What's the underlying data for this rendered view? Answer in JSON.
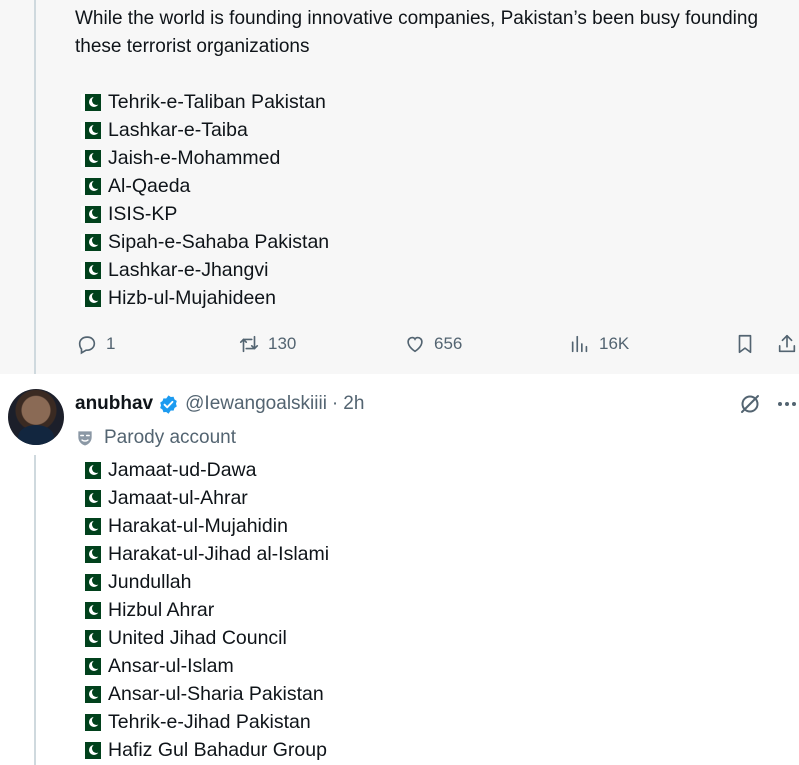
{
  "post1": {
    "intro": "While the world is founding innovative companies, Pakistan’s been busy founding these terrorist organizations",
    "items": [
      "Tehrik-e-Taliban Pakistan",
      "Lashkar-e-Taiba",
      "Jaish-e-Mohammed",
      "Al-Qaeda",
      "ISIS-KP",
      "Sipah-e-Sahaba Pakistan",
      "Lashkar-e-Jhangvi",
      "Hizb-ul-Mujahideen"
    ],
    "actions": {
      "replies": "1",
      "reposts": "130",
      "likes": "656",
      "views": "16K"
    }
  },
  "post2": {
    "display_name": "anubhav",
    "handle": "@Iewangoalskiiii",
    "separator": "·",
    "time": "2h",
    "parody_label": "Parody account",
    "items": [
      "Jamaat-ud-Dawa",
      "Jamaat-ul-Ahrar",
      "Harakat-ul-Mujahidin",
      "Harakat-ul-Jihad al-Islami",
      "Jundullah",
      "Hizbul Ahrar",
      "United Jihad Council",
      "Ansar-ul-Islam",
      "Ansar-ul-Sharia Pakistan",
      "Tehrik-e-Jihad Pakistan",
      "Hafiz Gul Bahadur Group"
    ]
  },
  "icons": {
    "flag": "pakistan-flag-icon",
    "reply": "reply-icon",
    "repost": "repost-icon",
    "like": "heart-icon",
    "views": "views-icon",
    "bookmark": "bookmark-icon",
    "share": "share-icon",
    "verified": "verified-badge-icon",
    "parody": "parody-mask-icon",
    "grok": "grok-icon",
    "more": "more-icon"
  },
  "colors": {
    "text": "#0f1419",
    "muted": "#536471",
    "verified": "#1d9bf0",
    "flag_green": "#01411c",
    "quoted_bg": "#f7f7f7"
  }
}
